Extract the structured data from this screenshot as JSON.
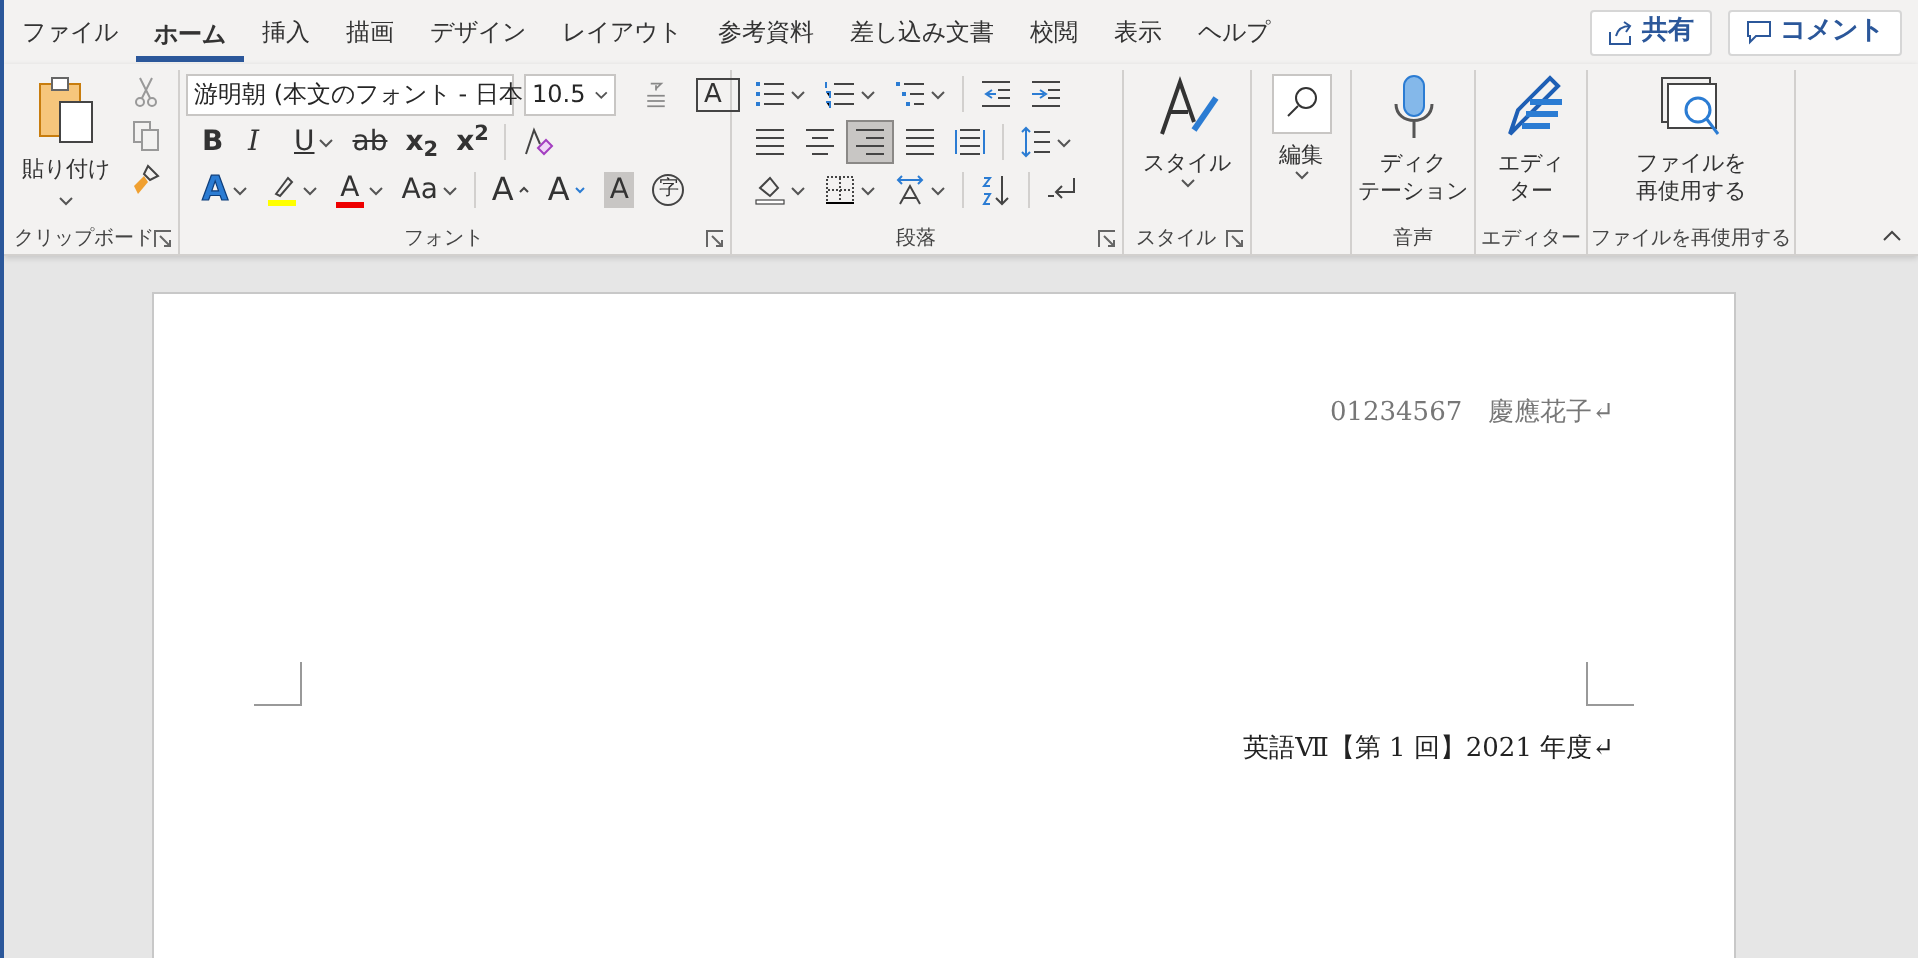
{
  "tabs": [
    {
      "label": "ファイル",
      "selected": false
    },
    {
      "label": "ホーム",
      "selected": true
    },
    {
      "label": "挿入",
      "selected": false
    },
    {
      "label": "描画",
      "selected": false
    },
    {
      "label": "デザイン",
      "selected": false
    },
    {
      "label": "レイアウト",
      "selected": false
    },
    {
      "label": "参考資料",
      "selected": false
    },
    {
      "label": "差し込み文書",
      "selected": false
    },
    {
      "label": "校閲",
      "selected": false
    },
    {
      "label": "表示",
      "selected": false
    },
    {
      "label": "ヘルプ",
      "selected": false
    }
  ],
  "header_buttons": [
    {
      "kind": "share",
      "label": "共有"
    },
    {
      "kind": "comment",
      "label": "コメント"
    }
  ],
  "clipboard": {
    "paste_label": "貼り付け",
    "group_label": "クリップボード",
    "launcher": true
  },
  "font": {
    "font_name": "游明朝 (本文のフォント - 日本",
    "font_size": "10.5",
    "char_border": "A",
    "group_label": "フォント",
    "launcher": true,
    "format_buttons": [
      {
        "kind": "bold",
        "label": "B",
        "dropdown": false,
        "selected": false
      },
      {
        "kind": "italic",
        "label": "I",
        "dropdown": false,
        "selected": false
      },
      {
        "kind": "underline",
        "label": "U",
        "dropdown": true,
        "selected": false
      },
      {
        "kind": "strike",
        "label": "ab",
        "dropdown": false,
        "selected": false
      },
      {
        "kind": "subscript",
        "label": "x$_{2}$",
        "dropdown": false,
        "selected": false
      },
      {
        "kind": "superscript",
        "label": "x$^{2}$",
        "dropdown": false,
        "selected": false
      },
      {
        "kind": "clear",
        "dropdown": false,
        "selected": false
      }
    ],
    "effect_buttons": [
      {
        "kind": "effect",
        "label": "A",
        "dropdown": true,
        "selected": false
      },
      {
        "kind": "highlight",
        "dropdown": true,
        "selected": false
      },
      {
        "kind": "color",
        "label": "A",
        "dropdown": true,
        "selected": false
      },
      {
        "kind": "case",
        "label": "Aa",
        "dropdown": true,
        "selected": false
      },
      {
        "kind": "grow",
        "label": "A",
        "dropdown": false,
        "selected": false
      },
      {
        "kind": "shrink",
        "label": "A",
        "dropdown": false,
        "selected": false
      },
      {
        "kind": "shade",
        "label": "A",
        "dropdown": false,
        "selected": false
      },
      {
        "kind": "enclose",
        "label": "字",
        "dropdown": false,
        "selected": false
      }
    ]
  },
  "paragraph": {
    "group_label": "段落",
    "launcher": true,
    "list_buttons": [
      {
        "kind": "bullets",
        "dropdown": true,
        "selected": false
      },
      {
        "kind": "numbering",
        "dropdown": true,
        "selected": false
      },
      {
        "kind": "multilevel",
        "dropdown": true,
        "selected": false
      },
      {
        "kind": "outdent",
        "dropdown": false,
        "selected": false
      },
      {
        "kind": "indent",
        "dropdown": false,
        "selected": false
      }
    ],
    "align_buttons": [
      {
        "kind": "align-left",
        "dropdown": false,
        "selected": false
      },
      {
        "kind": "align-center",
        "dropdown": false,
        "selected": false
      },
      {
        "kind": "align-right",
        "dropdown": false,
        "selected": true
      },
      {
        "kind": "justify",
        "dropdown": false,
        "selected": false
      },
      {
        "kind": "distribute",
        "dropdown": false,
        "selected": false
      },
      {
        "kind": "spacing",
        "dropdown": true,
        "selected": false
      }
    ],
    "layout_buttons": [
      {
        "kind": "shading",
        "dropdown": true,
        "selected": false
      },
      {
        "kind": "borders",
        "dropdown": true,
        "selected": false
      },
      {
        "kind": "direction",
        "dropdown": true,
        "selected": false
      },
      {
        "kind": "sort",
        "dropdown": false,
        "selected": false
      },
      {
        "kind": "marks",
        "dropdown": false,
        "selected": false
      }
    ]
  },
  "big_groups": [
    {
      "kind": "styles",
      "lines": [
        "スタイル"
      ],
      "dropdown": true,
      "group_label": "スタイル",
      "launcher": true
    },
    {
      "kind": "editing",
      "lines": [
        "編集"
      ],
      "dropdown": true,
      "launcher": false
    },
    {
      "kind": "dictate",
      "lines": [
        "ディク",
        "テーション"
      ],
      "dropdown": false,
      "group_label": "音声",
      "launcher": false
    },
    {
      "kind": "editor",
      "lines": [
        "エディ",
        "ター"
      ],
      "dropdown": false,
      "group_label": "エディター",
      "launcher": false
    },
    {
      "kind": "reuse",
      "lines": [
        "ファイルを",
        "再使用する"
      ],
      "dropdown": false,
      "group_label": "ファイルを再使用する",
      "launcher": false
    }
  ],
  "document": {
    "header_text": "01234567　慶應花子↵",
    "title": "英語Ⅶ【第 1 回】2021 年度↵"
  }
}
